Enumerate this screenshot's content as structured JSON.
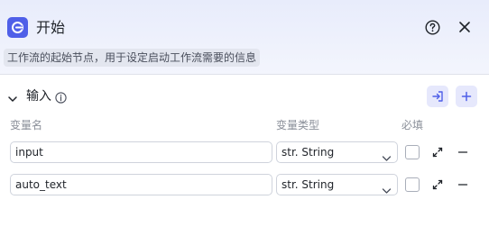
{
  "node": {
    "title": "开始",
    "description": "工作流的起始节点，用于设定启动工作流需要的信息",
    "icon": "start-node-icon"
  },
  "header_icons": {
    "help": "question-circle-icon",
    "close": "close-icon"
  },
  "inputs_section": {
    "title": "输入",
    "info_icon": "info-circle-icon",
    "import_icon": "import-icon",
    "add_icon": "plus-icon"
  },
  "columns": {
    "name": "变量名",
    "type": "变量类型",
    "required": "必填"
  },
  "variables": [
    {
      "name": "input",
      "type": "str. String",
      "required": false
    },
    {
      "name": "auto_text",
      "type": "str. String",
      "required": false
    }
  ],
  "colors": {
    "accent": "#4f5fe8",
    "accent_light": "#e6e8fc",
    "header_bg": "#e8ecfb",
    "border": "#cfd3dc",
    "muted_text": "#8a8f99"
  }
}
